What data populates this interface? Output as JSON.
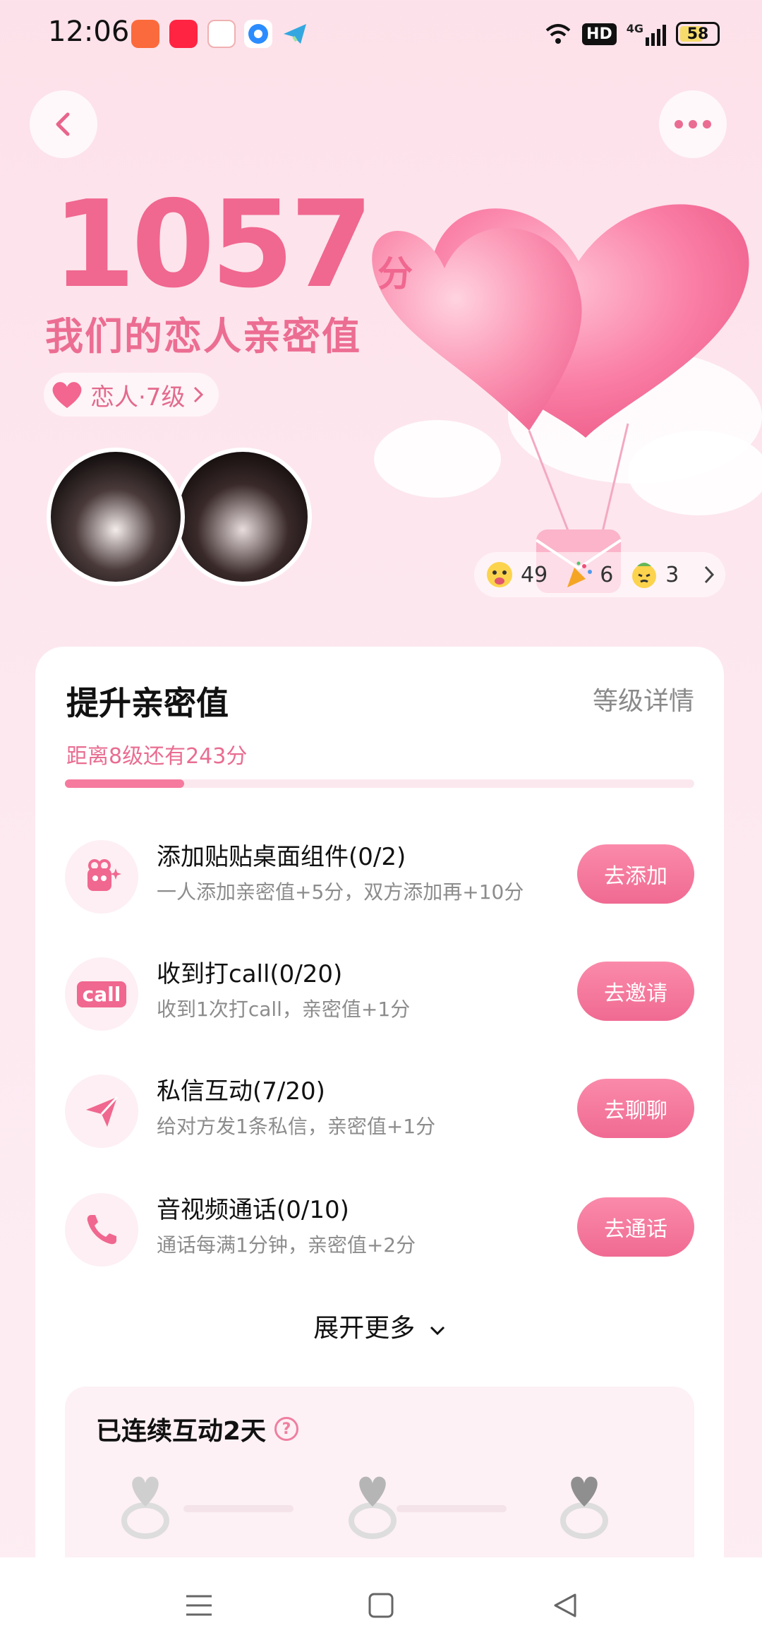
{
  "status_bar": {
    "time": "12:06",
    "hd": "HD",
    "network": "4G",
    "battery": "58",
    "apps": [
      "kuaishou-icon",
      "xiaohongshu-icon",
      "game-icon",
      "browser-icon",
      "telegram-icon"
    ]
  },
  "header": {
    "back_icon": "chevron-left-icon",
    "more_icon": "more-dots-icon"
  },
  "intimacy": {
    "score": "1057",
    "unit": "分",
    "title": "我们的恋人亲密值",
    "level": "恋人·7级"
  },
  "reactions": [
    {
      "icon": "hug-emoji-icon",
      "count": "49"
    },
    {
      "icon": "party-popper-icon",
      "count": "6"
    },
    {
      "icon": "pout-emoji-icon",
      "count": "3"
    }
  ],
  "card": {
    "title": "提升亲密值",
    "link": "等级详情",
    "distance": "距离8级还有243分",
    "progress": 0.19,
    "tasks": [
      {
        "icon": "sticker-widget-icon",
        "title": "添加贴贴桌面组件(0/2)",
        "desc": "一人添加亲密值+5分，双方添加再+10分",
        "button": "去添加"
      },
      {
        "icon": "call-icon",
        "title": "收到打call(0/20)",
        "desc": "收到1次打call，亲密值+1分",
        "button": "去邀请"
      },
      {
        "icon": "send-message-icon",
        "title": "私信互动(7/20)",
        "desc": "给对方发1条私信，亲密值+1分",
        "button": "去聊聊"
      },
      {
        "icon": "phone-icon",
        "title": "音视频通话(0/10)",
        "desc": "通话每满1分钟，亲密值+2分",
        "button": "去通话"
      }
    ],
    "expand": "展开更多",
    "call_badge": "call",
    "streak": {
      "title": "已连续互动2天",
      "help": "?"
    }
  },
  "colors": {
    "accent": "#f0678f",
    "button": "#f47299",
    "background": "#fde6ee"
  }
}
